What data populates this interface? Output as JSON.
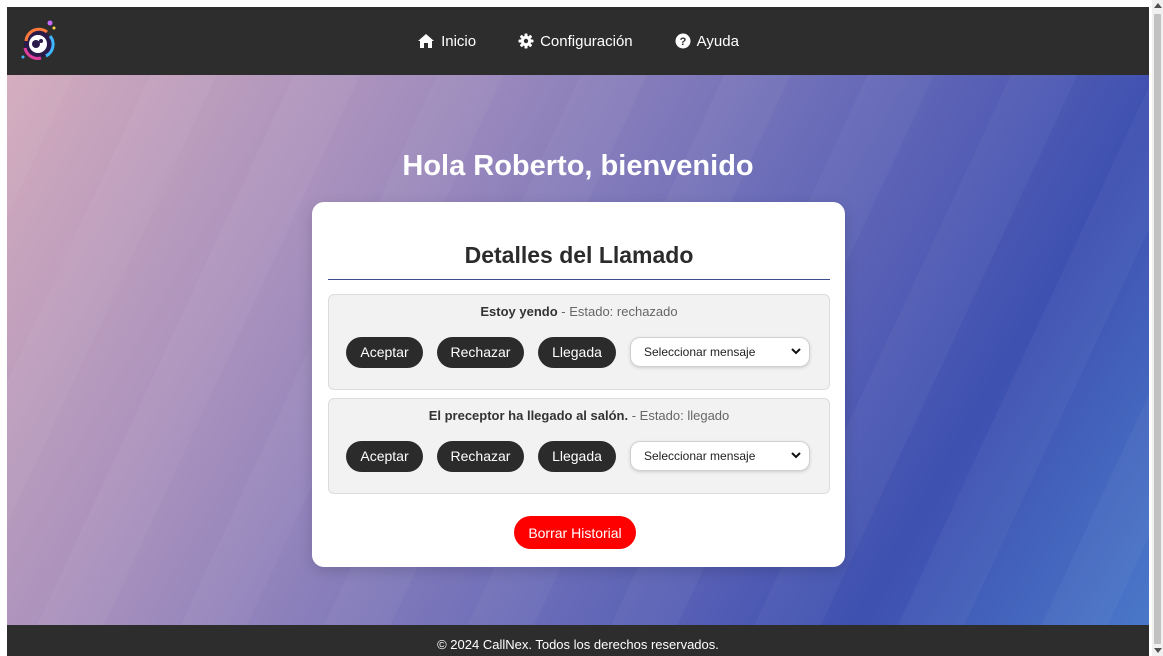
{
  "nav": {
    "items": [
      {
        "label": "Inicio",
        "icon": "home-icon"
      },
      {
        "label": "Configuración",
        "icon": "gear-icon"
      },
      {
        "label": "Ayuda",
        "icon": "help-icon"
      }
    ]
  },
  "main": {
    "greeting": "Hola Roberto, bienvenido",
    "card_title": "Detalles del Llamado",
    "calls": [
      {
        "message": "Estoy yendo",
        "status_text": " - Estado: rechazado",
        "accept_label": "Aceptar",
        "reject_label": "Rechazar",
        "arrived_label": "Llegada",
        "select_value": "Seleccionar mensaje"
      },
      {
        "message": "El preceptor ha llegado al salón.",
        "status_text": " - Estado: llegado",
        "accept_label": "Aceptar",
        "reject_label": "Rechazar",
        "arrived_label": "Llegada",
        "select_value": "Seleccionar mensaje"
      }
    ],
    "clear_history_label": "Borrar Historial"
  },
  "footer": {
    "text": "© 2024 CallNex. Todos los derechos reservados."
  },
  "colors": {
    "navbar": "#2d2d2d",
    "pill_button": "#2b2b2b",
    "danger_button": "#ff0000",
    "card_rule": "#3d4d8f"
  }
}
